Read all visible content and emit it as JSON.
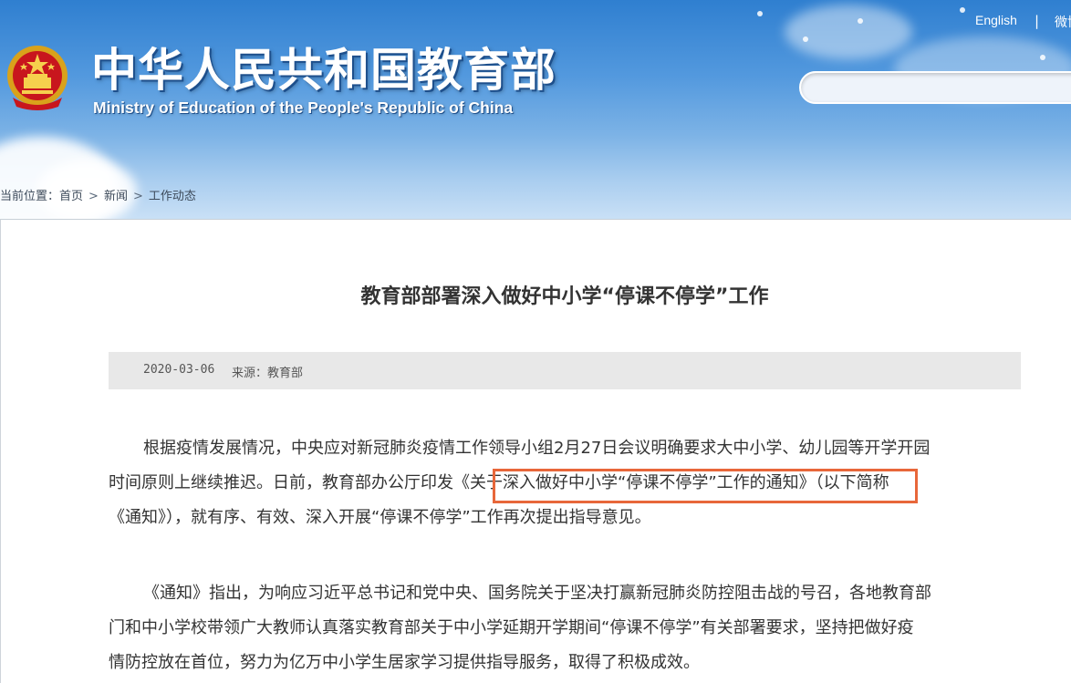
{
  "header": {
    "site_title": "中华人民共和国教育部",
    "site_subtitle": "Ministry of Education of the People's Republic of China",
    "lang_english": "English",
    "lang_divider": "|",
    "lang_weibo": "微博",
    "search_placeholder": "",
    "brand_color": "#2f7fd0"
  },
  "breadcrumb": {
    "prefix": "当前位置：",
    "items": [
      "首页",
      "新闻",
      "工作动态"
    ],
    "separator": ">"
  },
  "article": {
    "title": "教育部部署深入做好中小学“停课不停学”工作",
    "date": "2020-03-06",
    "source": "来源：教育部",
    "paragraph_1_lines": [
      "根据疫情发展情况，中央应对新冠肺炎疫情工作领导小组2月27日会议明确要求大中小学、幼儿园等开学开园",
      "时间原则上继续推迟。日前，教育部办公厅印发《关于深入做好中小学“停课不停学”工作的通知》（以下简称",
      "《通知》），就有序、有效、深入开展“停课不停学”工作再次提出指导意见。"
    ],
    "paragraph_2_lines": [
      "《通知》指出，为响应习近平总书记和党中央、国务院关于坚决打赢新冠肺炎防控阻击战的号召，各地教育部",
      "门和中小学校带领广大教师认真落实教育部关于中小学延期开学期间“停课不停学”有关部署要求，坚持把做好疫",
      "情防控放在首位，努力为亿万中小学生居家学习提供指导服务，取得了积极成效。"
    ],
    "highlight_color": "#e8673a"
  }
}
